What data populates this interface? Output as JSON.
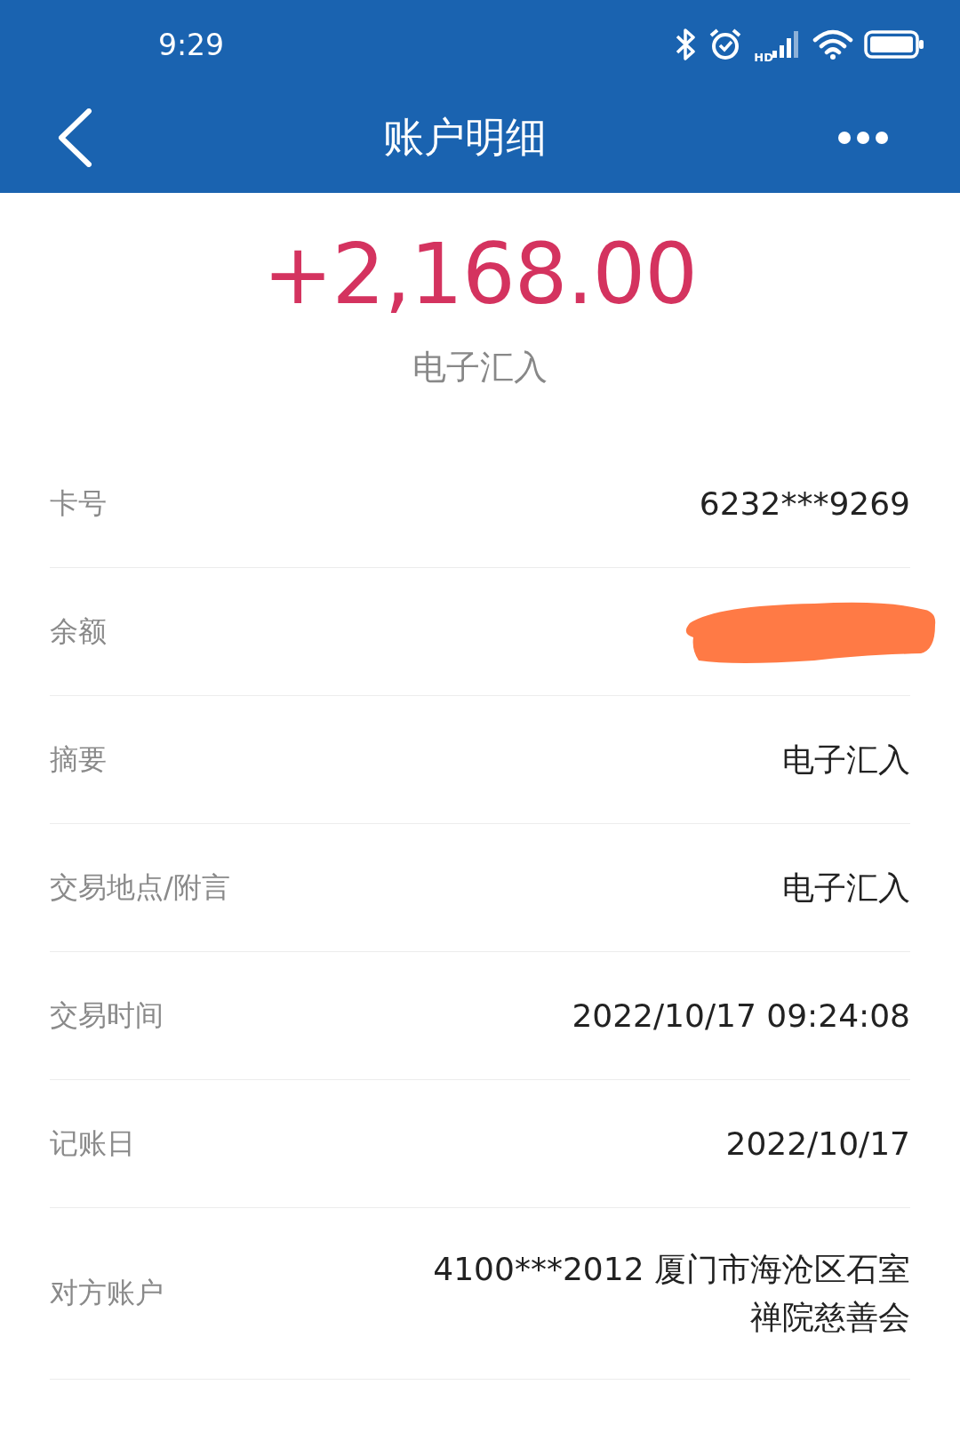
{
  "status_bar": {
    "time": "9:29",
    "network_label": "HD"
  },
  "header": {
    "title": "账户明细"
  },
  "amount": "+2,168.00",
  "type": "电子汇入",
  "rows": [
    {
      "kind": "text",
      "label": "卡号",
      "value": "6232***9269"
    },
    {
      "kind": "redacted",
      "label": "余额"
    },
    {
      "kind": "text",
      "label": "摘要",
      "value": "电子汇入"
    },
    {
      "kind": "text",
      "label": "交易地点/附言",
      "value": "电子汇入"
    },
    {
      "kind": "text",
      "label": "交易时间",
      "value": "2022/10/17 09:24:08"
    },
    {
      "kind": "text",
      "label": "记账日",
      "value": "2022/10/17"
    },
    {
      "kind": "text",
      "label": "对方账户",
      "value": "4100***2012 厦门市海沧区石室禅院慈善会"
    }
  ]
}
